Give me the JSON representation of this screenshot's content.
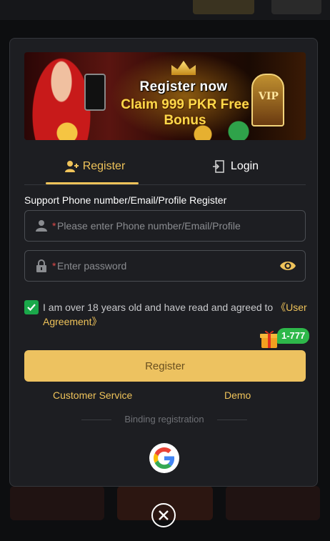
{
  "banner": {
    "line1": "Register now",
    "line2": "Claim 999 PKR Free Bonus",
    "vip": "VIP"
  },
  "tabs": [
    {
      "label": "Register",
      "icon": "add-user-icon",
      "active": true
    },
    {
      "label": "Login",
      "icon": "login-door-icon",
      "active": false
    }
  ],
  "form": {
    "support_label": "Support Phone number/Email/Profile Register",
    "account_placeholder": "Please enter Phone number/Email/Profile",
    "password_placeholder": "Enter password",
    "required_mark": "*"
  },
  "agreement": {
    "text": "I am over 18 years old and have read and agreed to ",
    "link": "《User Agreement》",
    "checked": true
  },
  "promo_badge": "1-777",
  "register_button": "Register",
  "links": {
    "customer_service": "Customer Service",
    "demo": "Demo"
  },
  "binding_label": "Binding registration",
  "colors": {
    "accent": "#efc35a",
    "button": "#edc260",
    "check": "#1aa84a",
    "modal_bg": "#1d1e22"
  }
}
